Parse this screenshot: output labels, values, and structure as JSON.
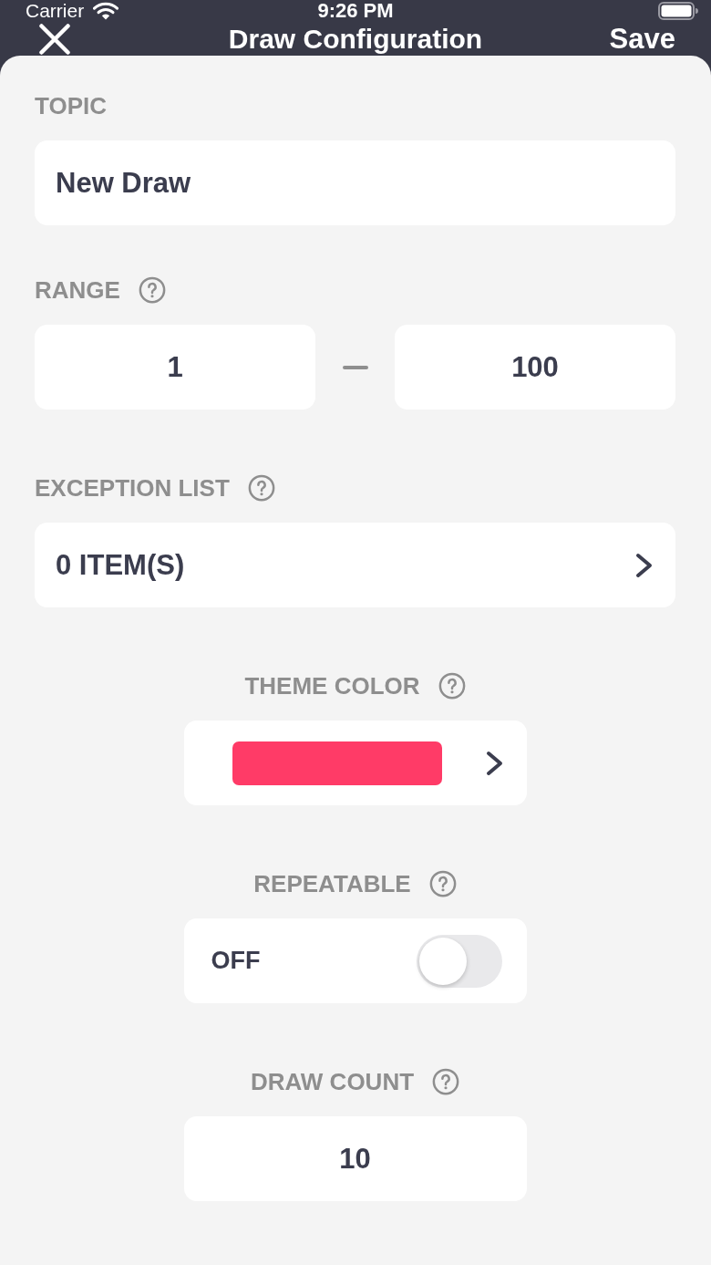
{
  "status_bar": {
    "carrier": "Carrier",
    "time": "9:26 PM"
  },
  "nav": {
    "title": "Draw Configuration",
    "action": "Save"
  },
  "sections": [
    {
      "kind": "text",
      "label": "TOPIC",
      "help": false,
      "value": "New Draw"
    },
    {
      "kind": "range",
      "label": "RANGE",
      "help": true,
      "from": "1",
      "to": "100"
    },
    {
      "kind": "list",
      "label": "EXCEPTION LIST",
      "help": true,
      "value": "0 ITEM(S)"
    },
    {
      "kind": "color",
      "label": "THEME COLOR",
      "help": true,
      "color": "#ff3b67"
    },
    {
      "kind": "toggle",
      "label": "REPEATABLE",
      "help": true,
      "on": false,
      "value": "OFF"
    },
    {
      "kind": "number",
      "label": "DRAW COUNT",
      "help": true,
      "value": "10"
    }
  ]
}
